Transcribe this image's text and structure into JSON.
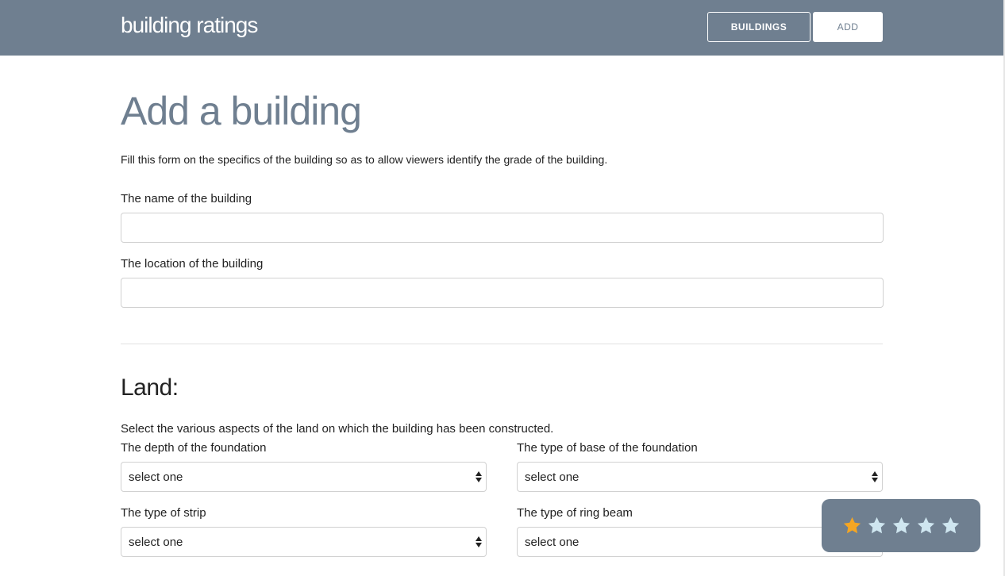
{
  "navbar": {
    "brand": "building ratings",
    "links": [
      {
        "label": "BUILDINGS"
      },
      {
        "label": "ADD"
      }
    ]
  },
  "page": {
    "title": "Add a building",
    "intro": "Fill this form on the specifics of the building so as to allow viewers identify the grade of the building."
  },
  "form": {
    "name_label": "The name of the building",
    "name_value": "",
    "location_label": "The location of the building",
    "location_value": ""
  },
  "land": {
    "title": "Land:",
    "description": "Select the various aspects of the land on which the building has been constructed.",
    "fields": [
      {
        "label": "The depth of the foundation",
        "value": "select one"
      },
      {
        "label": "The type of base of the foundation",
        "value": "select one"
      },
      {
        "label": "The type of strip",
        "value": "select one"
      },
      {
        "label": "The type of ring beam",
        "value": "select one"
      }
    ]
  },
  "rating": {
    "value": 1,
    "max": 5,
    "active_color": "#f5a623",
    "inactive_color": "#cfe6f0"
  }
}
